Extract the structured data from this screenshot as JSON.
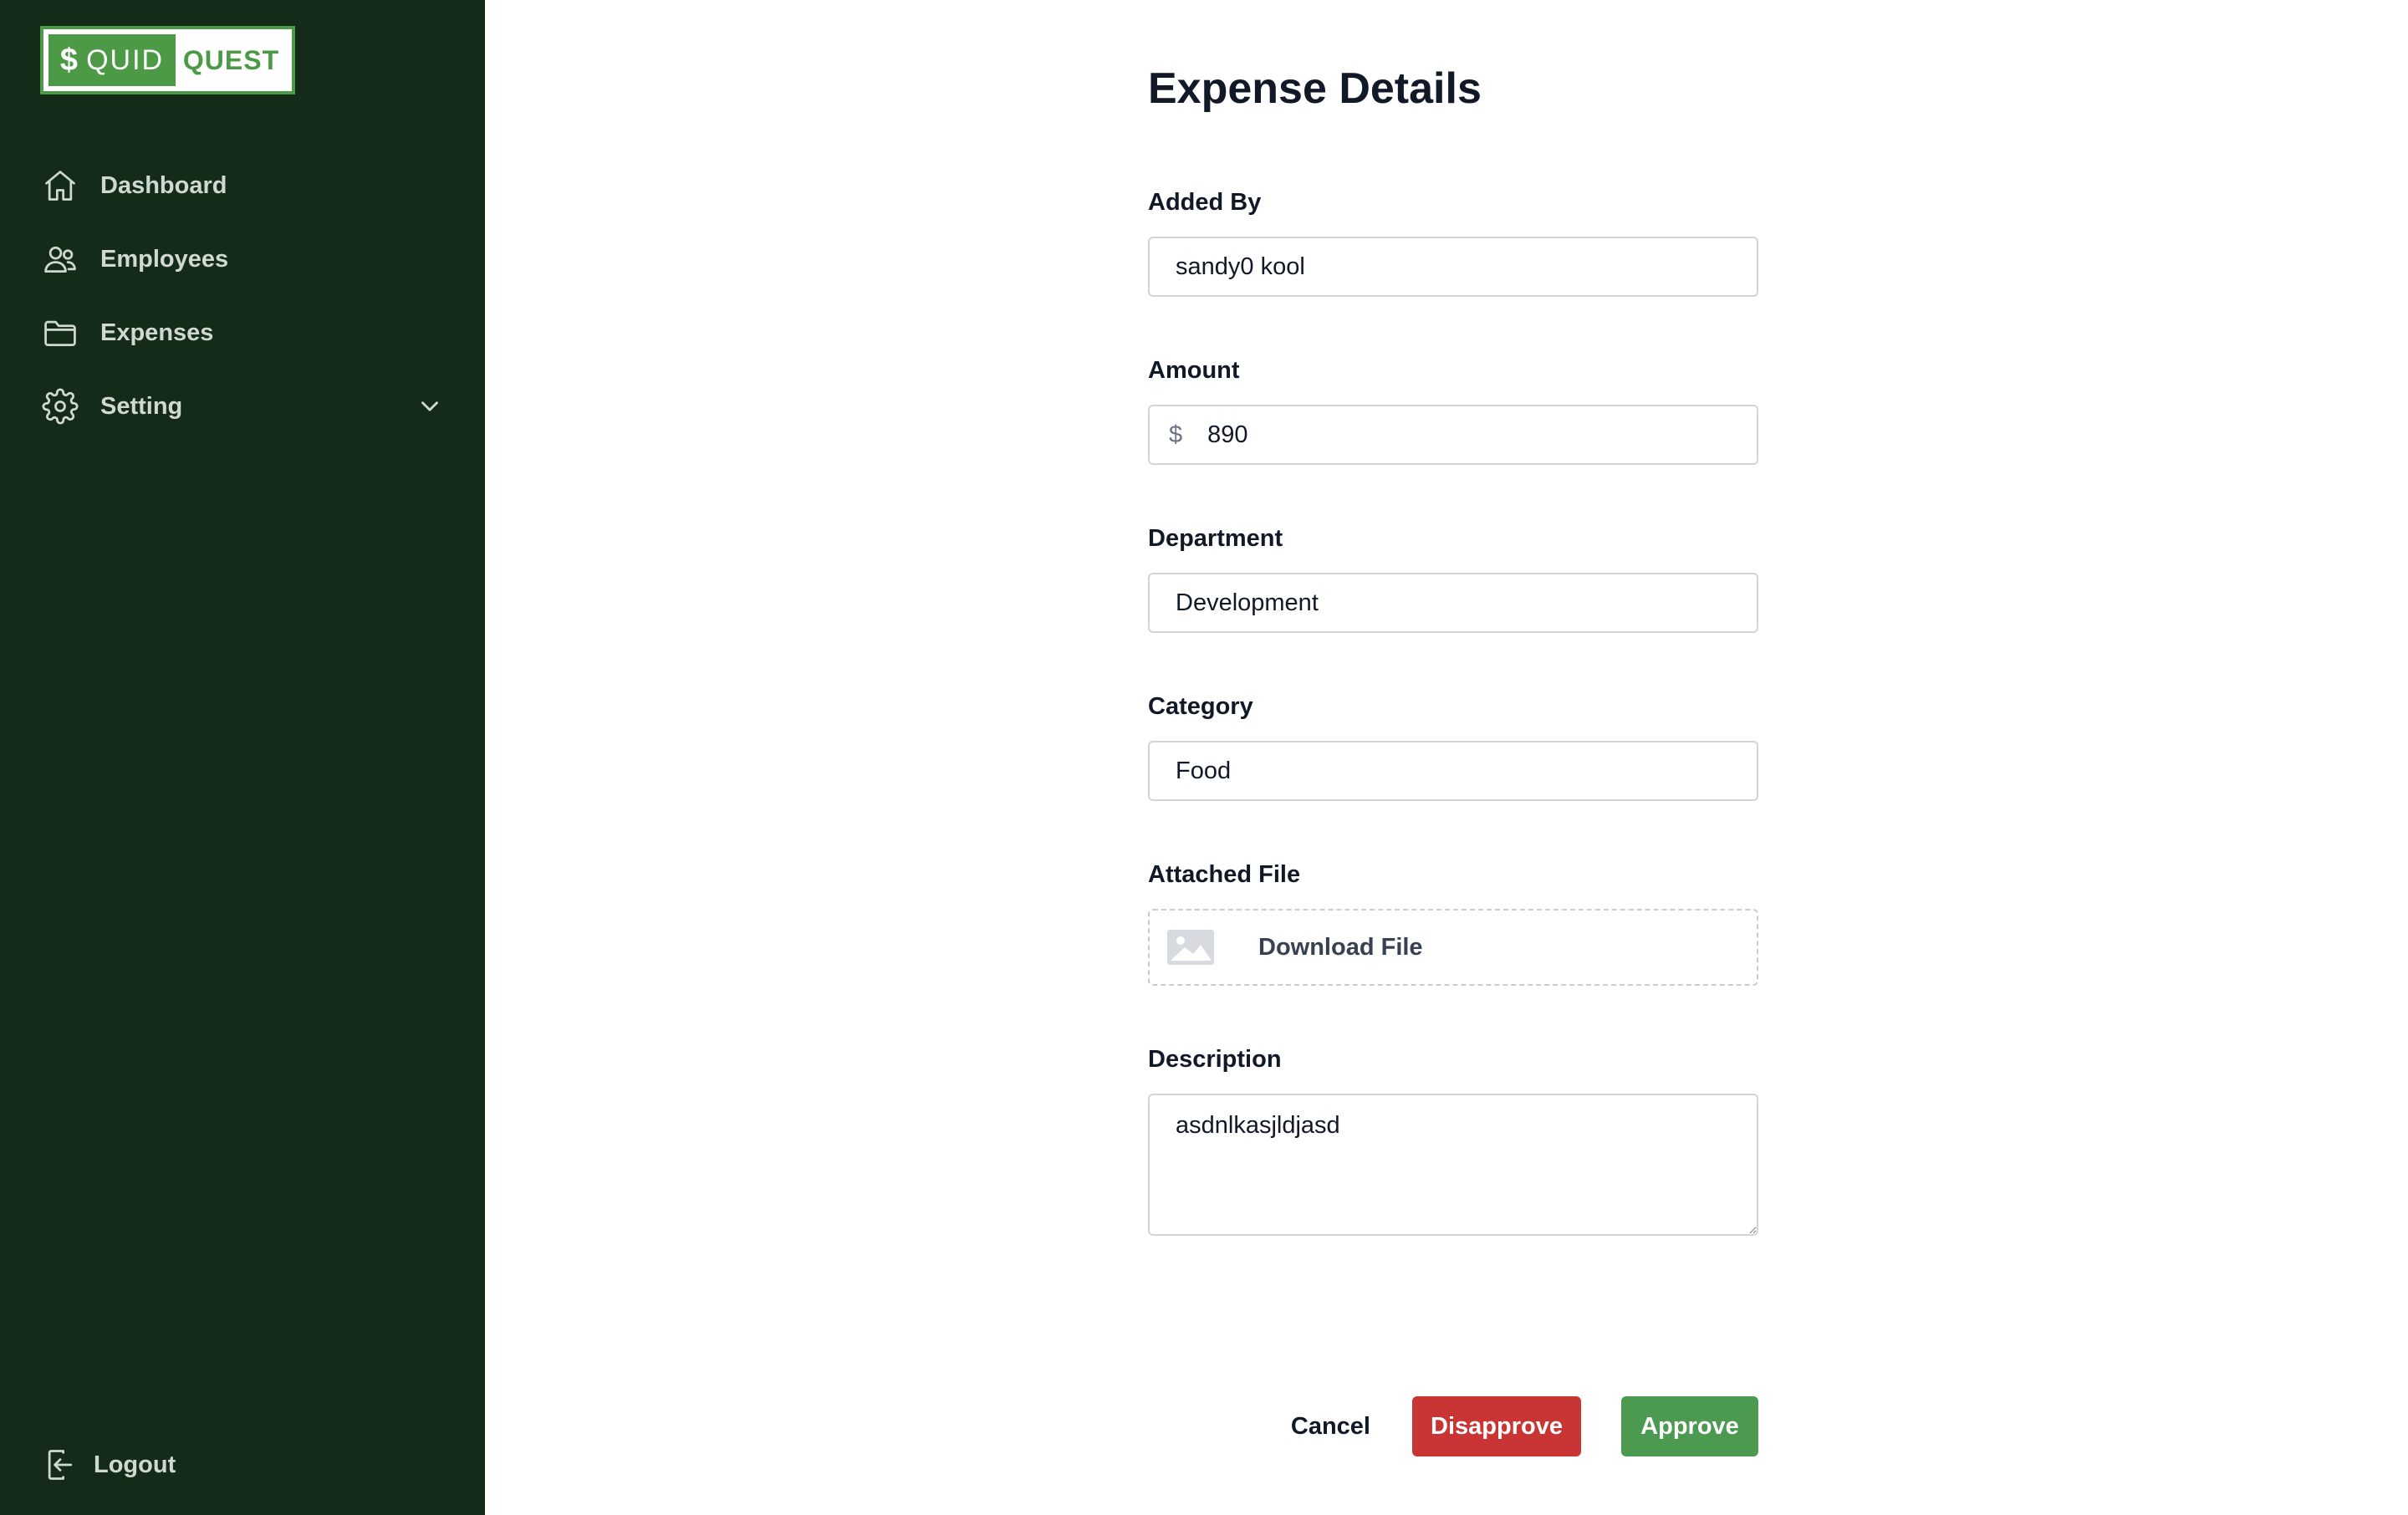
{
  "brand": {
    "dollar": "$",
    "left_text": "QUID",
    "right_text": "QUEST",
    "color": "#4c9a45"
  },
  "sidebar": {
    "background": "#142b1a",
    "items": [
      {
        "label": "Dashboard",
        "icon": "home-icon"
      },
      {
        "label": "Employees",
        "icon": "users-icon"
      },
      {
        "label": "Expenses",
        "icon": "folder-icon"
      },
      {
        "label": "Setting",
        "icon": "gear-icon",
        "has_submenu": true
      }
    ],
    "logout_label": "Logout"
  },
  "form": {
    "title": "Expense Details",
    "added_by": {
      "label": "Added By",
      "value": "sandy0 kool"
    },
    "amount": {
      "label": "Amount",
      "prefix": "$",
      "value": "890"
    },
    "department": {
      "label": "Department",
      "value": "Development"
    },
    "category": {
      "label": "Category",
      "value": "Food"
    },
    "attached_file": {
      "label": "Attached File",
      "action_label": "Download File",
      "icon": "image-icon"
    },
    "description": {
      "label": "Description",
      "value": "asdnlkasjldjasd"
    }
  },
  "actions": {
    "cancel_label": "Cancel",
    "disapprove_label": "Disapprove",
    "approve_label": "Approve",
    "disapprove_color": "#c93434",
    "approve_color": "#4c9a50"
  }
}
